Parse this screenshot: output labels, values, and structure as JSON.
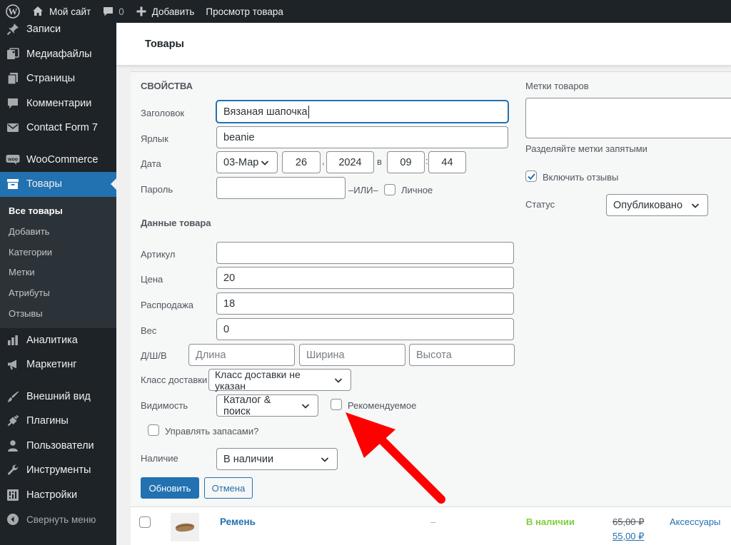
{
  "admin_bar": {
    "site_name": "Мой сайт",
    "comments_count": "0",
    "add_label": "Добавить",
    "view_label": "Просмотр товара"
  },
  "sidebar": {
    "items": [
      {
        "label": "Записи",
        "icon": "pin-icon"
      },
      {
        "label": "Медиафайлы",
        "icon": "media-icon"
      },
      {
        "label": "Страницы",
        "icon": "pages-icon"
      },
      {
        "label": "Комментарии",
        "icon": "comment-icon"
      },
      {
        "label": "Contact Form 7",
        "icon": "mail-icon"
      },
      {
        "label": "WooCommerce",
        "icon": "woo-icon"
      },
      {
        "label": "Товары",
        "icon": "archive-icon"
      },
      {
        "label": "Аналитика",
        "icon": "chart-icon"
      },
      {
        "label": "Маркетинг",
        "icon": "megaphone-icon"
      },
      {
        "label": "Внешний вид",
        "icon": "brush-icon"
      },
      {
        "label": "Плагины",
        "icon": "plugin-icon"
      },
      {
        "label": "Пользователи",
        "icon": "users-icon"
      },
      {
        "label": "Инструменты",
        "icon": "wrench-icon"
      },
      {
        "label": "Настройки",
        "icon": "settings-icon"
      }
    ],
    "submenu": [
      "Все товары",
      "Добавить",
      "Категории",
      "Метки",
      "Атрибуты",
      "Отзывы"
    ],
    "collapse_label": "Свернуть меню"
  },
  "header": {
    "title": "Товары"
  },
  "quick_edit": {
    "section_title": "Свойства",
    "title_label": "Заголовок",
    "title_value": "Вязаная шапочка",
    "slug_label": "Ярлык",
    "slug_value": "beanie",
    "date_label": "Дата",
    "date_month": "03-Мар",
    "date_day": "26",
    "date_year": "2024",
    "date_at": "в",
    "date_hour": "09",
    "date_minute": "44",
    "password_label": "Пароль",
    "or_label": "–ИЛИ–",
    "private_label": "Личное",
    "product_data_title": "Данные товара",
    "sku_label": "Артикул",
    "sku_value": "",
    "price_label": "Цена",
    "price_value": "20",
    "sale_label": "Распродажа",
    "sale_value": "18",
    "weight_label": "Вес",
    "weight_value": "0",
    "dims_label": "Д/Ш/В",
    "length_placeholder": "Длина",
    "width_placeholder": "Ширина",
    "height_placeholder": "Высота",
    "shipping_label": "Класс доставки",
    "shipping_value": "Класс доставки не указан",
    "visibility_label": "Видимость",
    "visibility_value": "Каталог & поиск",
    "featured_label": "Рекомендуемое",
    "manage_stock_label": "Управлять запасами?",
    "stock_label": "Наличие",
    "stock_value": "В наличии",
    "update_button": "Обновить",
    "cancel_button": "Отмена",
    "tags_label": "Метки товаров",
    "tags_hint": "Разделяйте метки запятыми",
    "comments_label": "Включить отзывы",
    "comments_checked": true,
    "status_label": "Статус",
    "status_value": "Опубликовано"
  },
  "product_row": {
    "name": "Ремень",
    "sku": "–",
    "stock": "В наличии",
    "price_old": "65,00 ₽",
    "price_new": "55,00 ₽",
    "category": "Аксессуары"
  },
  "colors": {
    "accent": "#2271b1",
    "sidebar_bg": "#1d2327",
    "in_stock": "#7ad03a",
    "annotation_arrow": "#ff0000"
  }
}
